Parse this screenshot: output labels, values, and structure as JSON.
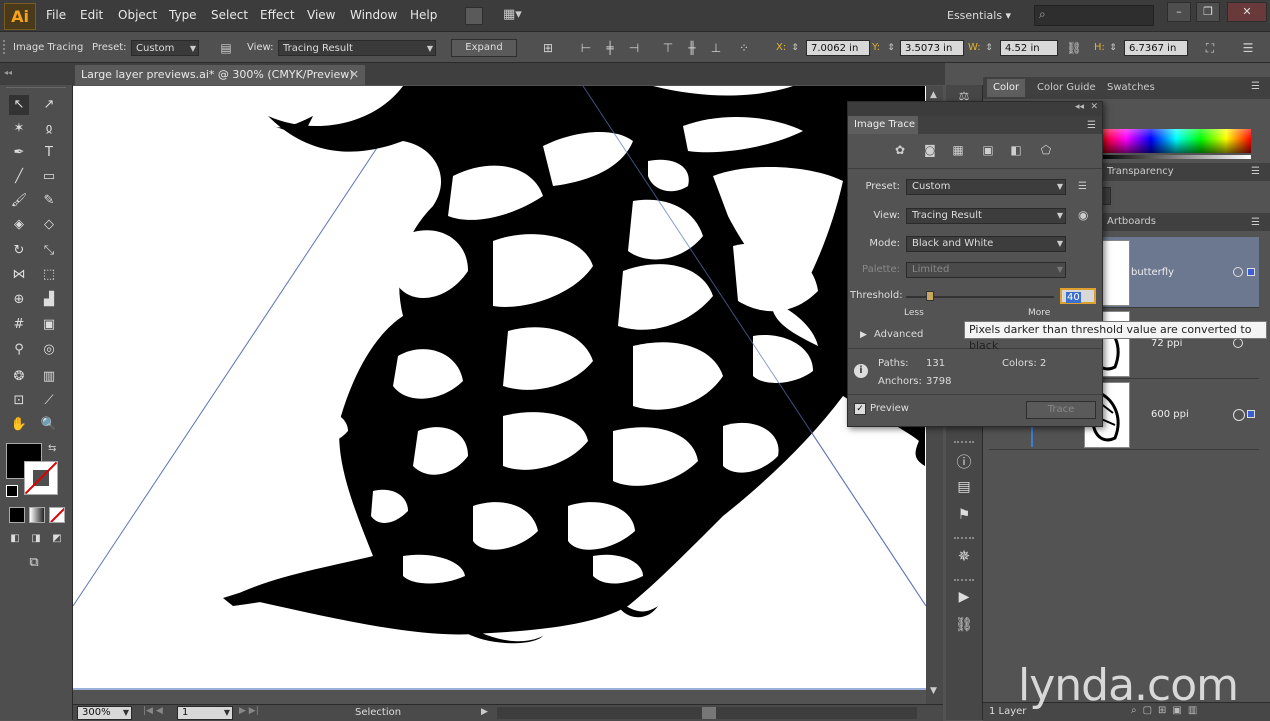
{
  "app": {
    "logo": "Ai"
  },
  "menu": [
    "File",
    "Edit",
    "Object",
    "Type",
    "Select",
    "Effect",
    "View",
    "Window",
    "Help"
  ],
  "workspace": "Essentials",
  "window_controls": {
    "minimize": "–",
    "restore": "❐",
    "close": "✕"
  },
  "control_bar": {
    "mode_label": "Image Tracing",
    "preset_label": "Preset:",
    "preset_value": "Custom",
    "view_label": "View:",
    "view_value": "Tracing Result",
    "expand_button": "Expand",
    "x_label": "X:",
    "x_value": "7.0062 in",
    "y_label": "Y:",
    "y_value": "3.5073 in",
    "w_label": "W:",
    "w_value": "4.52 in",
    "h_label": "H:",
    "h_value": "6.7367 in"
  },
  "document_tab": "Large layer previews.ai* @ 300% (CMYK/Preview)",
  "status_bar": {
    "zoom": "300%",
    "artboard": "1",
    "tool": "Selection"
  },
  "image_trace": {
    "title": "Image Trace",
    "preset_label": "Preset:",
    "preset_value": "Custom",
    "view_label": "View:",
    "view_value": "Tracing Result",
    "mode_label": "Mode:",
    "mode_value": "Black and White",
    "palette_label": "Palette:",
    "palette_value": "Limited",
    "threshold_label": "Threshold:",
    "threshold_value": "40",
    "threshold_fraction": 0.16,
    "less_label": "Less",
    "more_label": "More",
    "advanced_label": "Advanced",
    "paths_label": "Paths:",
    "paths_value": "131",
    "colors_label": "Colors:",
    "colors_value": "2",
    "anchors_label": "Anchors:",
    "anchors_value": "3798",
    "preview_label": "Preview",
    "trace_button": "Trace"
  },
  "tooltip": "Pixels darker than threshold value are converted to black",
  "panels": {
    "tabs": [
      "Color",
      "Color Guide",
      "Swatches"
    ],
    "transparency_tab": "Transparency",
    "artboards_tab": "Artboards",
    "layers": [
      {
        "name": "butterfly"
      },
      {
        "name": "72 ppi"
      },
      {
        "name": "600 ppi"
      }
    ],
    "layer_count": "1 Layer"
  },
  "watermark": "lynda.com"
}
